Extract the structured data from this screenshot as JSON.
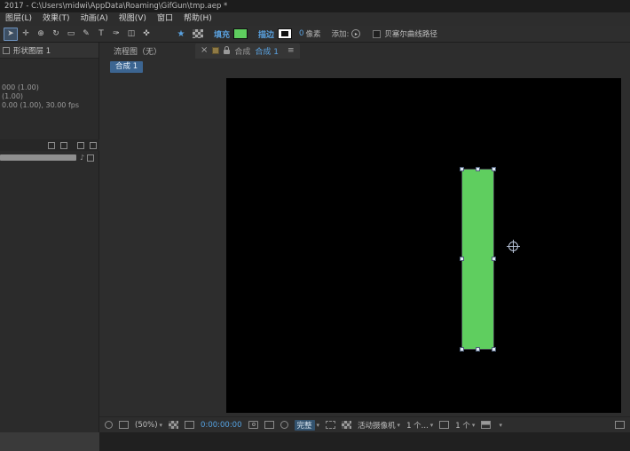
{
  "titlebar": {
    "title": "2017 - C:\\Users\\midwi\\AppData\\Roaming\\GifGun\\tmp.aep *"
  },
  "menubar": {
    "items": [
      {
        "label": "图层(L)"
      },
      {
        "label": "效果(T)"
      },
      {
        "label": "动画(A)"
      },
      {
        "label": "视图(V)"
      },
      {
        "label": "窗口"
      },
      {
        "label": "帮助(H)"
      }
    ]
  },
  "toolbar": {
    "tools": [
      {
        "name": "selection",
        "icon": "➤"
      },
      {
        "name": "hand",
        "icon": "✛"
      },
      {
        "name": "zoom",
        "icon": "⊕"
      },
      {
        "name": "rotation",
        "icon": "↻"
      },
      {
        "name": "rectangle",
        "icon": "▭"
      },
      {
        "name": "pen",
        "icon": "✎"
      },
      {
        "name": "type",
        "icon": "T"
      },
      {
        "name": "brush",
        "icon": "✑"
      },
      {
        "name": "clone-stamp",
        "icon": "◫"
      },
      {
        "name": "puppet",
        "icon": "✜"
      }
    ],
    "star_icon": "★",
    "fill_label": "填充",
    "fill_color": "#5fce5f",
    "stroke_label": "描边",
    "stroke_width_value": "0",
    "stroke_width_unit": "像素",
    "add_label": "添加:",
    "bezier_label": "贝塞尔曲线路径"
  },
  "left_panel": {
    "tab_label": "形状图层 1",
    "info_lines": [
      "000 (1.00)",
      "(1.00)",
      "0.00 (1.00), 30.00 fps"
    ]
  },
  "comp_panel": {
    "tab_flowchart": "流程图（无）",
    "tab_comp_prefix": "合成",
    "tab_comp_name": "合成 1",
    "breadcrumb": "合成 1",
    "bottombar": {
      "zoom": "(50%)",
      "timecode": "0:00:00:00",
      "resolution": "完整",
      "camera": "活动摄像机",
      "views": "1 个...",
      "views2": "1 个"
    }
  },
  "viewport": {
    "shape_color": "#5fce5f"
  },
  "glyphs": {
    "menu": "≡",
    "close": "×",
    "caret": "▾",
    "note": "♪",
    "arrow": "▸"
  }
}
